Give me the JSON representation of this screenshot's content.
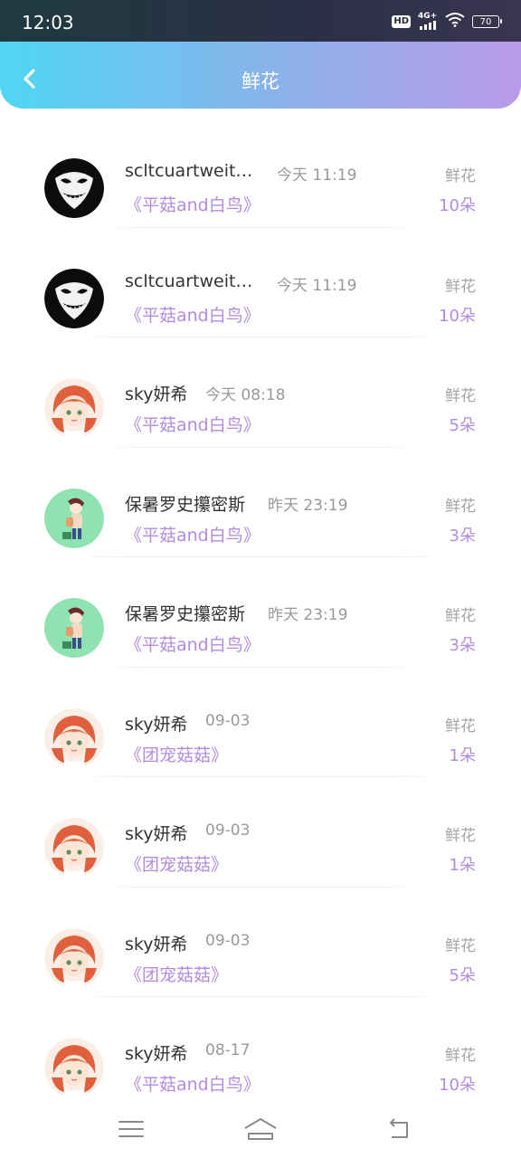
{
  "status_bar": {
    "time": "12:03",
    "hd": "HD",
    "network": "4G+",
    "battery": "70"
  },
  "header": {
    "title": "鲜花",
    "back_icon": "chevron-left-icon"
  },
  "colors": {
    "accent": "#b38be0",
    "gradient_start": "#4fd6f3",
    "gradient_end": "#b99ae9"
  },
  "gifts": [
    {
      "avatar": "skull-mask-avatar",
      "name": "scltcuartweit…",
      "time": "今天 11:19",
      "book": "《平菇and白鸟》",
      "label": "鲜花",
      "count": "10朵"
    },
    {
      "avatar": "skull-mask-avatar",
      "name": "scltcuartweit…",
      "time": "今天 11:19",
      "book": "《平菇and白鸟》",
      "label": "鲜花",
      "count": "10朵"
    },
    {
      "avatar": "anime-girl-avatar",
      "name": "sky妍希",
      "time": "今天 08:18",
      "book": "《平菇and白鸟》",
      "label": "鲜花",
      "count": "5朵"
    },
    {
      "avatar": "anime-boy-avatar",
      "name": "保暑罗史攥密斯",
      "time": "昨天 23:19",
      "book": "《平菇and白鸟》",
      "label": "鲜花",
      "count": "3朵"
    },
    {
      "avatar": "anime-boy-avatar",
      "name": "保暑罗史攥密斯",
      "time": "昨天 23:19",
      "book": "《平菇and白鸟》",
      "label": "鲜花",
      "count": "3朵"
    },
    {
      "avatar": "anime-girl-avatar",
      "name": "sky妍希",
      "time": "09-03",
      "book": "《团宠菇菇》",
      "label": "鲜花",
      "count": "1朵"
    },
    {
      "avatar": "anime-girl-avatar",
      "name": "sky妍希",
      "time": "09-03",
      "book": "《团宠菇菇》",
      "label": "鲜花",
      "count": "1朵"
    },
    {
      "avatar": "anime-girl-avatar",
      "name": "sky妍希",
      "time": "09-03",
      "book": "《团宠菇菇》",
      "label": "鲜花",
      "count": "5朵"
    },
    {
      "avatar": "anime-girl-avatar",
      "name": "sky妍希",
      "time": "08-17",
      "book": "《平菇and白鸟》",
      "label": "鲜花",
      "count": "10朵"
    }
  ],
  "nav_bar": {
    "menu_icon": "menu-icon",
    "home_icon": "home-icon",
    "back_icon": "back-icon"
  }
}
